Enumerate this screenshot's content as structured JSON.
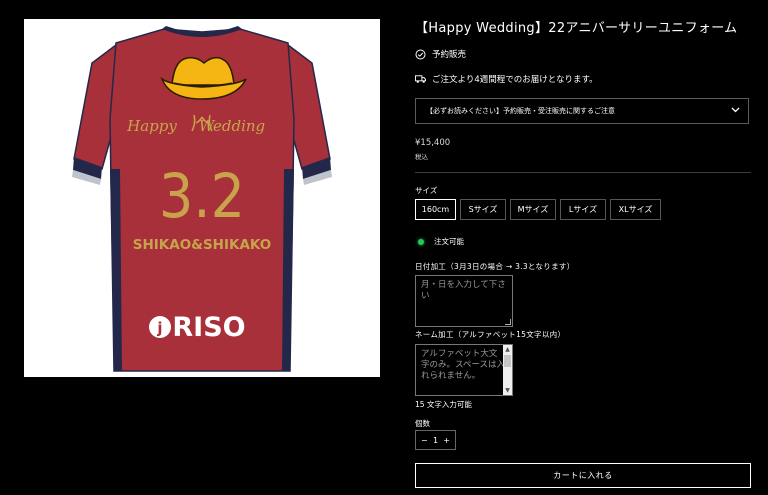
{
  "product": {
    "title": "【Happy Wedding】22アニバーサリーユニフォーム",
    "preorder_label": "予約販売",
    "shipping_note": "ご注文より4週間程でのお届けとなります。",
    "notice_label": "【必ずお読みください】予約販売・受注販売に関するご注意",
    "price": "¥15,400",
    "tax_note": "税込"
  },
  "jersey": {
    "script_text_left": "Happy",
    "script_text_right": "Wedding",
    "number": "3.2",
    "names": "SHIKAO&SHIKAKO",
    "sponsor": "RISO",
    "sponsor_mark": "j",
    "colors": {
      "body": "#a8303a",
      "sleeve": "#23284a",
      "gold": "#c9a34b"
    }
  },
  "size": {
    "label": "サイズ",
    "options": [
      "160cm",
      "Sサイズ",
      "Mサイズ",
      "Lサイズ",
      "XLサイズ"
    ],
    "selected": "160cm"
  },
  "stock_status": "注文可能",
  "date_field": {
    "label": "日付加工（3月3日の場合 → 3.3となります）",
    "placeholder": "月・日を入力して下さい"
  },
  "name_field": {
    "label": "ネーム加工（アルファベット15文字以内）",
    "placeholder": "アルファベット大文字のみ。スペースは入れられません。",
    "counter": "15 文字入力可能"
  },
  "quantity": {
    "label": "個数",
    "value": "1",
    "minus": "−",
    "plus": "+"
  },
  "cart_button": "カートに入れる",
  "icons": {
    "preorder": "check-badge-icon",
    "shipping": "truck-icon",
    "notice": "chevron-down-icon"
  }
}
